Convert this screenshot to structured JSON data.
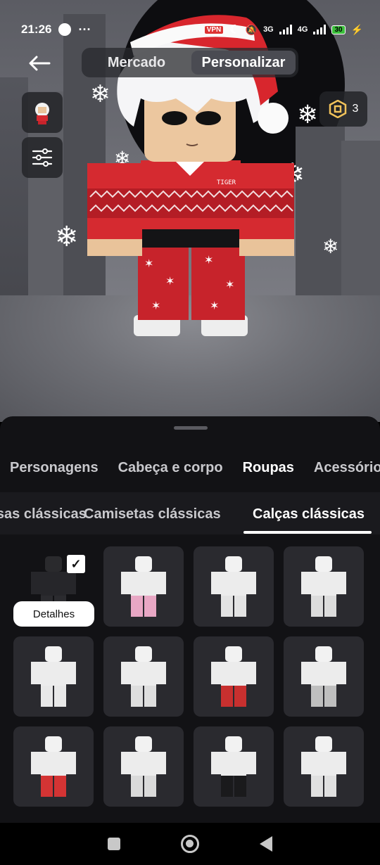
{
  "status_bar": {
    "time": "21:26",
    "vpn_label": "VPN",
    "network_1": "3G",
    "network_2": "4G",
    "battery": "30"
  },
  "header": {
    "tabs": [
      {
        "label": "Mercado",
        "active": false
      },
      {
        "label": "Personalizar",
        "active": true
      }
    ]
  },
  "robux": {
    "count": "3"
  },
  "avatar_shirt_text": "TIGER",
  "categories": [
    {
      "label": "Personagens",
      "active": false
    },
    {
      "label": "Cabeça e corpo",
      "active": false
    },
    {
      "label": "Roupas",
      "active": true
    },
    {
      "label": "Acessórios",
      "active": false
    }
  ],
  "subcategories": [
    {
      "label": "Camisas clássicas",
      "active": false
    },
    {
      "label": "Camisetas clássicas",
      "active": false
    },
    {
      "label": "Calças clássicas",
      "active": true
    }
  ],
  "details_label": "Detalhes",
  "items": [
    {
      "pants": "#2b2b2f",
      "selected": true
    },
    {
      "pants": "#e8a7c4",
      "selected": false
    },
    {
      "pants": "#e3e3e3",
      "selected": false
    },
    {
      "pants": "#dcdcdc",
      "selected": false
    },
    {
      "pants": "#e8e8e8",
      "selected": false
    },
    {
      "pants": "#dedede",
      "selected": false
    },
    {
      "pants": "#c8302f",
      "selected": false
    },
    {
      "pants": "#bfbfbf",
      "selected": false
    },
    {
      "pants": "#d43434",
      "selected": false
    },
    {
      "pants": "#dadada",
      "selected": false
    },
    {
      "pants": "#1a1a1c",
      "selected": false
    },
    {
      "pants": "#e0e0e0",
      "selected": false
    }
  ]
}
